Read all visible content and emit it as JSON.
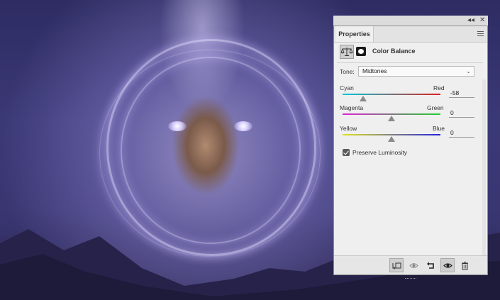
{
  "panel": {
    "topbar": {
      "collapse_glyph": "◂◂",
      "close_glyph": "✕"
    },
    "tab_label": "Properties",
    "header_title": "Color Balance",
    "tone": {
      "label": "Tone:",
      "value": "Midtones"
    },
    "sliders": [
      {
        "left_label": "Cyan",
        "right_label": "Red",
        "value": "-58",
        "level": -58
      },
      {
        "left_label": "Magenta",
        "right_label": "Green",
        "value": "0",
        "level": 0
      },
      {
        "left_label": "Yellow",
        "right_label": "Blue",
        "value": "0",
        "level": 0
      }
    ],
    "preserve_luminosity": {
      "label": "Preserve Luminosity",
      "checked": true
    },
    "footer_icons": [
      "clip-to-layer-icon",
      "view-previous-state-icon",
      "reset-icon",
      "visibility-eye-icon",
      "trash-icon"
    ]
  }
}
